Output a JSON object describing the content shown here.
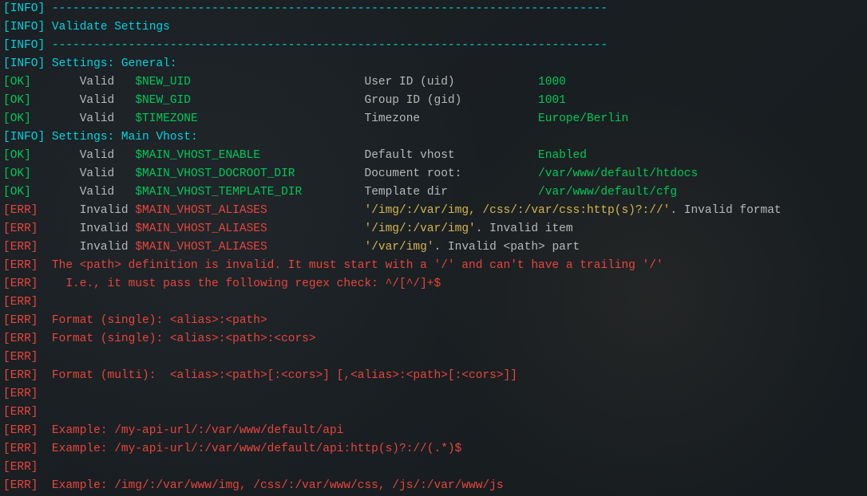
{
  "lines": [
    {
      "id": "l1",
      "segs": [
        {
          "cls": "tag-info",
          "key": "tag.info"
        },
        {
          "cls": "dash",
          "key": "sep.dash"
        }
      ]
    },
    {
      "id": "l2",
      "segs": [
        {
          "cls": "tag-info",
          "key": "tag.info"
        },
        {
          "cls": "title",
          "key": "t.validate"
        }
      ]
    },
    {
      "id": "l3",
      "segs": [
        {
          "cls": "tag-info",
          "key": "tag.info"
        },
        {
          "cls": "dash",
          "key": "sep.dash"
        }
      ]
    },
    {
      "id": "l4",
      "segs": [
        {
          "cls": "tag-info",
          "key": "tag.info"
        },
        {
          "cls": "section",
          "key": "sec.general"
        }
      ]
    },
    {
      "id": "l5",
      "segs": [
        {
          "cls": "tag-ok",
          "key": "tag.ok"
        },
        {
          "cls": "valid",
          "key": "w.pad4valid"
        },
        {
          "cls": "var-name",
          "key": "v.new_uid"
        },
        {
          "cls": "desc",
          "key": "d.uid"
        },
        {
          "cls": "val-green",
          "key": "val.1000"
        }
      ]
    },
    {
      "id": "l6",
      "segs": [
        {
          "cls": "tag-ok",
          "key": "tag.ok"
        },
        {
          "cls": "valid",
          "key": "w.pad4valid"
        },
        {
          "cls": "var-name",
          "key": "v.new_gid"
        },
        {
          "cls": "desc",
          "key": "d.gid"
        },
        {
          "cls": "val-green",
          "key": "val.1001"
        }
      ]
    },
    {
      "id": "l7",
      "segs": [
        {
          "cls": "tag-ok",
          "key": "tag.ok"
        },
        {
          "cls": "valid",
          "key": "w.pad4valid"
        },
        {
          "cls": "var-name",
          "key": "v.timezone"
        },
        {
          "cls": "desc",
          "key": "d.tz"
        },
        {
          "cls": "val-green",
          "key": "val.berlin"
        }
      ]
    },
    {
      "id": "l8",
      "segs": [
        {
          "cls": "tag-info",
          "key": "tag.info"
        },
        {
          "cls": "section",
          "key": "sec.vhost"
        }
      ]
    },
    {
      "id": "l9",
      "segs": [
        {
          "cls": "tag-ok",
          "key": "tag.ok"
        },
        {
          "cls": "valid",
          "key": "w.pad4valid"
        },
        {
          "cls": "var-name",
          "key": "v.mv_enable"
        },
        {
          "cls": "desc",
          "key": "d.defvhost"
        },
        {
          "cls": "val-green",
          "key": "val.enabled"
        }
      ]
    },
    {
      "id": "l10",
      "segs": [
        {
          "cls": "tag-ok",
          "key": "tag.ok"
        },
        {
          "cls": "valid",
          "key": "w.pad4valid"
        },
        {
          "cls": "var-name",
          "key": "v.mv_docroot"
        },
        {
          "cls": "desc",
          "key": "d.docroot"
        },
        {
          "cls": "val-green",
          "key": "val.htdocs"
        }
      ]
    },
    {
      "id": "l11",
      "segs": [
        {
          "cls": "tag-ok",
          "key": "tag.ok"
        },
        {
          "cls": "valid",
          "key": "w.pad4valid"
        },
        {
          "cls": "var-name",
          "key": "v.mv_tpl"
        },
        {
          "cls": "desc",
          "key": "d.tpl"
        },
        {
          "cls": "val-green",
          "key": "val.cfg"
        }
      ]
    },
    {
      "id": "l12",
      "segs": [
        {
          "cls": "tag-err",
          "key": "tag.err"
        },
        {
          "cls": "invalid",
          "key": "w.pad4invalid"
        },
        {
          "cls": "var-err",
          "key": "v.mv_aliases"
        },
        {
          "cls": "val-y",
          "key": "val.alias1"
        },
        {
          "cls": "white-txt",
          "key": "w.invfmt"
        }
      ]
    },
    {
      "id": "l13",
      "segs": [
        {
          "cls": "tag-err",
          "key": "tag.err"
        },
        {
          "cls": "invalid",
          "key": "w.pad4invalid"
        },
        {
          "cls": "var-err",
          "key": "v.mv_aliases"
        },
        {
          "cls": "val-y",
          "key": "val.alias2"
        },
        {
          "cls": "white-txt",
          "key": "w.invitem"
        }
      ]
    },
    {
      "id": "l14",
      "segs": [
        {
          "cls": "tag-err",
          "key": "tag.err"
        },
        {
          "cls": "invalid",
          "key": "w.pad4invalid"
        },
        {
          "cls": "var-err",
          "key": "v.mv_aliases"
        },
        {
          "cls": "val-y",
          "key": "val.alias3"
        },
        {
          "cls": "white-txt",
          "key": "w.invpath"
        }
      ]
    },
    {
      "id": "l15",
      "segs": [
        {
          "cls": "tag-err",
          "key": "tag.err"
        },
        {
          "cls": "err-txt",
          "key": "e.pathdef"
        }
      ]
    },
    {
      "id": "l16",
      "segs": [
        {
          "cls": "tag-err",
          "key": "tag.err"
        },
        {
          "cls": "err-txt",
          "key": "e.regex"
        }
      ]
    },
    {
      "id": "l17",
      "segs": [
        {
          "cls": "tag-err",
          "key": "tag.err"
        }
      ]
    },
    {
      "id": "l18",
      "segs": [
        {
          "cls": "tag-err",
          "key": "tag.err"
        },
        {
          "cls": "err-txt",
          "key": "e.fmt1"
        }
      ]
    },
    {
      "id": "l19",
      "segs": [
        {
          "cls": "tag-err",
          "key": "tag.err"
        },
        {
          "cls": "err-txt",
          "key": "e.fmt2"
        }
      ]
    },
    {
      "id": "l20",
      "segs": [
        {
          "cls": "tag-err",
          "key": "tag.err"
        }
      ]
    },
    {
      "id": "l21",
      "segs": [
        {
          "cls": "tag-err",
          "key": "tag.err"
        },
        {
          "cls": "err-txt",
          "key": "e.fmt3"
        }
      ]
    },
    {
      "id": "l22",
      "segs": [
        {
          "cls": "tag-err",
          "key": "tag.err"
        }
      ]
    },
    {
      "id": "l23",
      "segs": [
        {
          "cls": "tag-err",
          "key": "tag.err"
        }
      ]
    },
    {
      "id": "l24",
      "segs": [
        {
          "cls": "tag-err",
          "key": "tag.err"
        },
        {
          "cls": "err-txt",
          "key": "e.ex1"
        }
      ]
    },
    {
      "id": "l25",
      "segs": [
        {
          "cls": "tag-err",
          "key": "tag.err"
        },
        {
          "cls": "err-txt",
          "key": "e.ex2"
        }
      ]
    },
    {
      "id": "l26",
      "segs": [
        {
          "cls": "tag-err",
          "key": "tag.err"
        }
      ]
    },
    {
      "id": "l27",
      "segs": [
        {
          "cls": "tag-err",
          "key": "tag.err"
        },
        {
          "cls": "err-txt",
          "key": "e.ex3"
        }
      ]
    }
  ],
  "tag": {
    "info": "[INFO] ",
    "ok": "[OK]   ",
    "err": "[ERR]  "
  },
  "sep": {
    "dash": "--------------------------------------------------------------------------------"
  },
  "t": {
    "validate": "Validate Settings"
  },
  "sec": {
    "general": "Settings: General:",
    "vhost": "Settings: Main Vhost:"
  },
  "w": {
    "pad4valid": "    Valid   ",
    "pad4invalid": "    Invalid ",
    "invfmt": ". Invalid format",
    "invitem": ". Invalid item",
    "invpath": ". Invalid <path> part"
  },
  "v": {
    "new_uid": "$NEW_UID                         ",
    "new_gid": "$NEW_GID                         ",
    "timezone": "$TIMEZONE                        ",
    "mv_enable": "$MAIN_VHOST_ENABLE               ",
    "mv_docroot": "$MAIN_VHOST_DOCROOT_DIR          ",
    "mv_tpl": "$MAIN_VHOST_TEMPLATE_DIR         ",
    "mv_aliases": "$MAIN_VHOST_ALIASES              "
  },
  "d": {
    "uid": "User ID (uid)            ",
    "gid": "Group ID (gid)           ",
    "tz": "Timezone                 ",
    "defvhost": "Default vhost            ",
    "docroot": "Document root:           ",
    "tpl": "Template dir             "
  },
  "val": {
    "1000": "1000",
    "1001": "1001",
    "berlin": "Europe/Berlin",
    "enabled": "Enabled",
    "htdocs": "/var/www/default/htdocs",
    "cfg": "/var/www/default/cfg",
    "alias1": "'/img/:/var/img, /css/:/var/css:http(s)?://'",
    "alias2": "'/img/:/var/img'",
    "alias3": "'/var/img'"
  },
  "e": {
    "pathdef": "The <path> definition is invalid. It must start with a '/' and can't have a trailing '/'",
    "regex": "  I.e., it must pass the following regex check: ^/[^/]+$",
    "fmt1": "Format (single): <alias>:<path>",
    "fmt2": "Format (single): <alias>:<path>:<cors>",
    "fmt3": "Format (multi):  <alias>:<path>[:<cors>] [,<alias>:<path>[:<cors>]]",
    "ex1": "Example: /my-api-url/:/var/www/default/api",
    "ex2": "Example: /my-api-url/:/var/www/default/api:http(s)?://(.*)$",
    "ex3": "Example: /img/:/var/www/img, /css/:/var/www/css, /js/:/var/www/js"
  }
}
